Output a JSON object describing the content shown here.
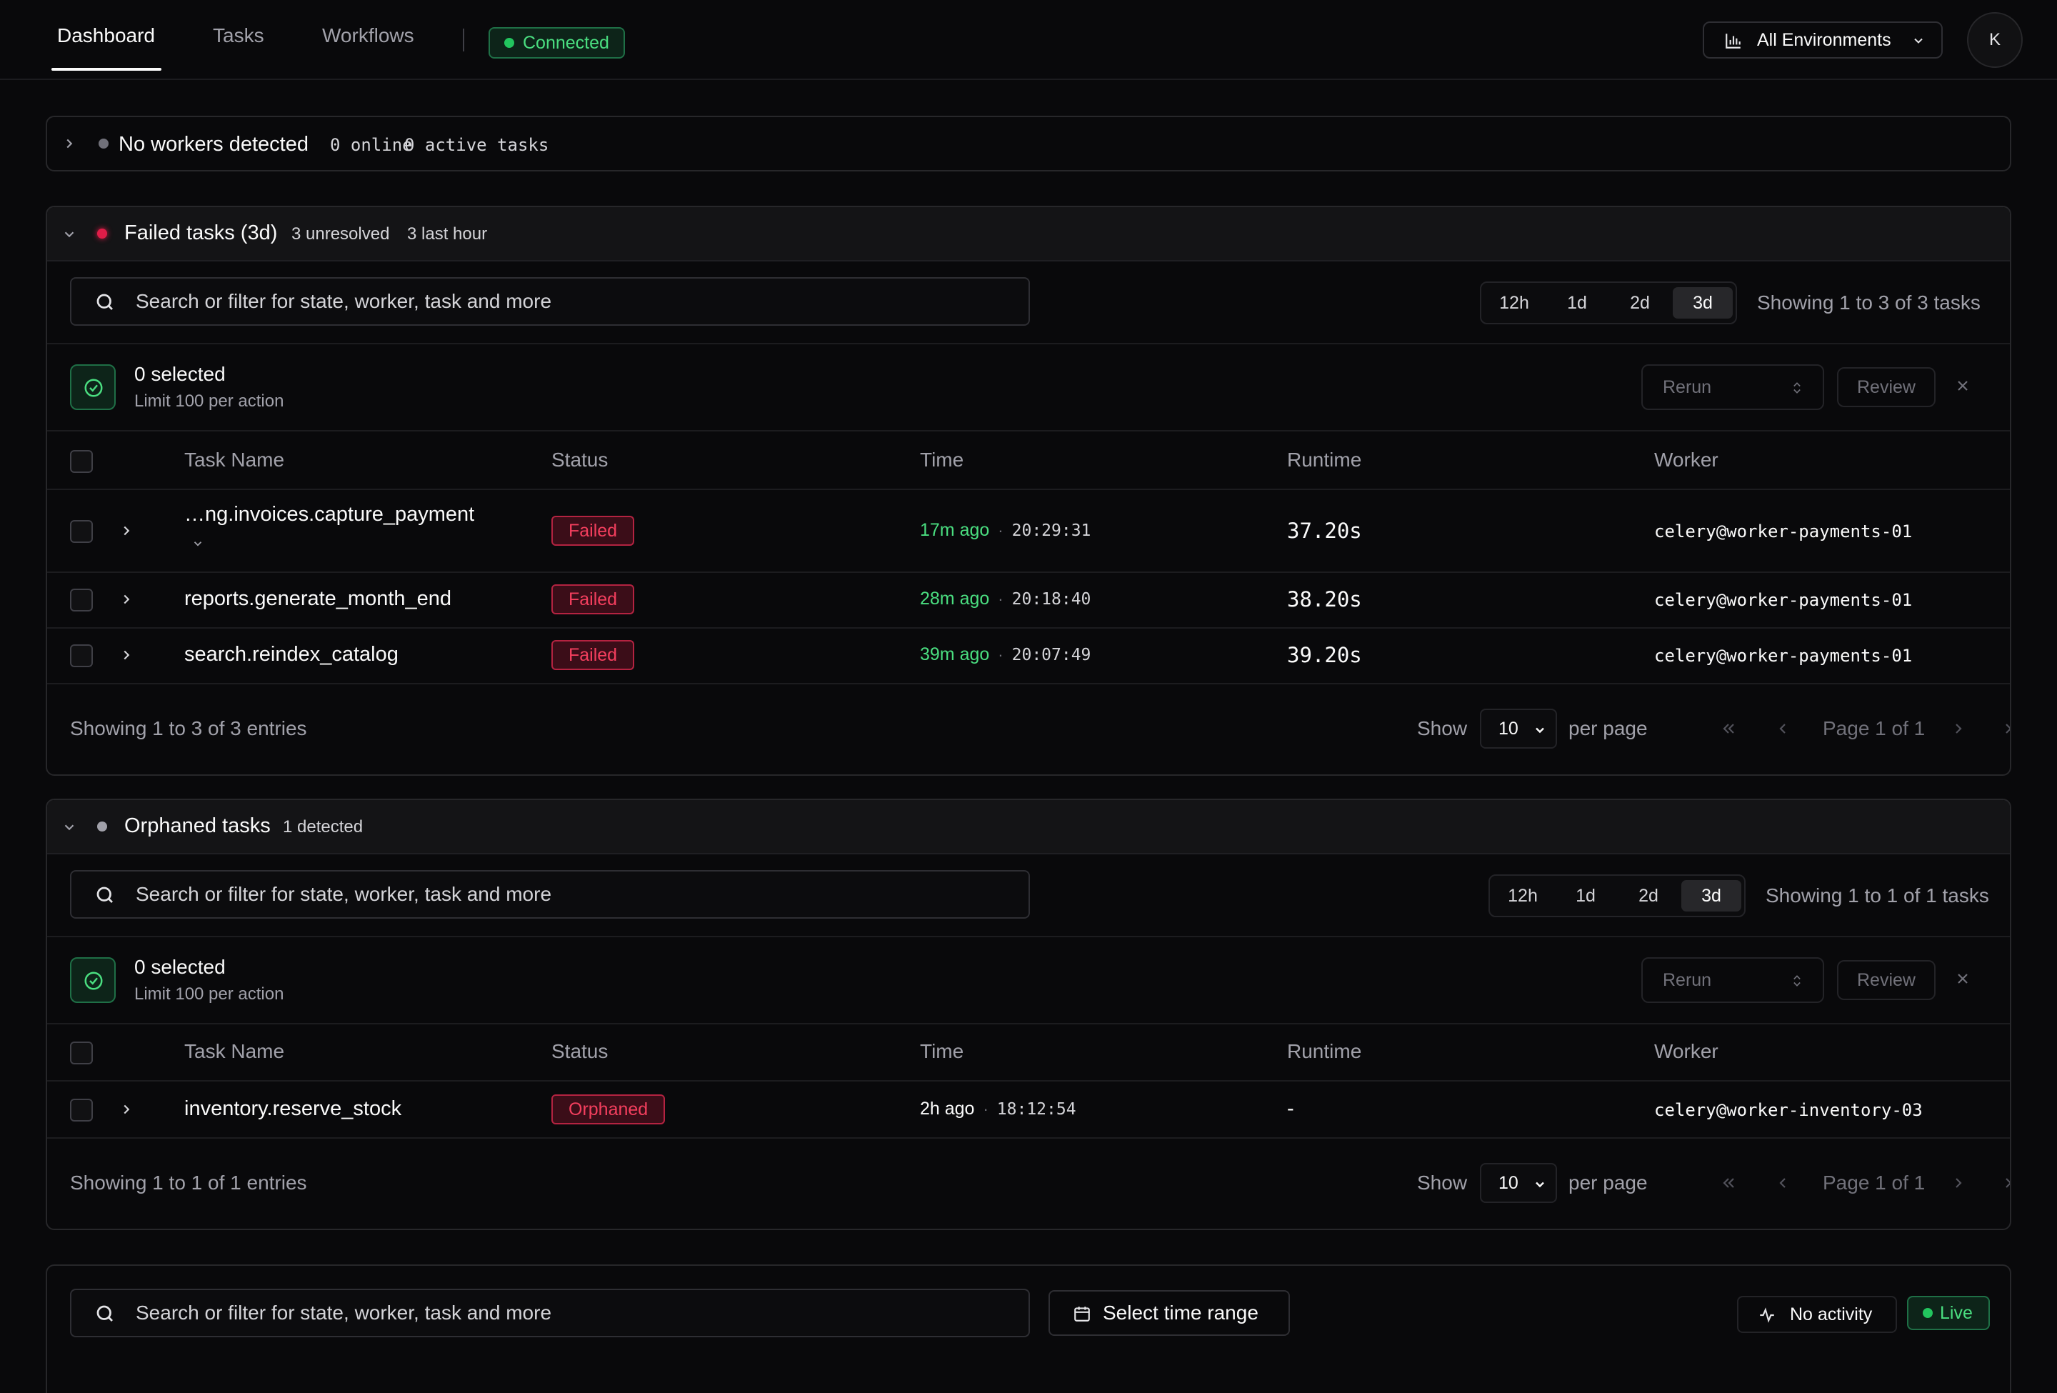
{
  "nav": {
    "tabs": [
      {
        "label": "Dashboard",
        "active": true
      },
      {
        "label": "Tasks",
        "active": false
      },
      {
        "label": "Workflows",
        "active": false
      }
    ],
    "connection_status": "Connected",
    "environment_label": "All Environments",
    "avatar_initial": "K"
  },
  "workers_panel": {
    "title": "No workers detected",
    "online": "0 online",
    "active_tasks": "0 active tasks"
  },
  "failed_panel": {
    "title": "Failed tasks (3d)",
    "unresolved": "3 unresolved",
    "last_hour": "3 last hour",
    "search_placeholder": "Search or filter for state, worker, task and more",
    "ranges": [
      "12h",
      "1d",
      "2d",
      "3d"
    ],
    "active_range": "3d",
    "range_summary": "Showing 1 to 3 of 3 tasks",
    "selected": "0 selected",
    "limit": "Limit 100 per action",
    "rerun_label": "Rerun",
    "review_label": "Review",
    "columns": [
      "Task Name",
      "Status",
      "Time",
      "Runtime",
      "Worker"
    ],
    "rows": [
      {
        "name": "…ng.invoices.capture_payment",
        "status": "Failed",
        "relative": "17m ago",
        "absolute": "20:29:31",
        "runtime": "37.20s",
        "worker": "celery@worker-payments-01"
      },
      {
        "name": "reports.generate_month_end",
        "status": "Failed",
        "relative": "28m ago",
        "absolute": "20:18:40",
        "runtime": "38.20s",
        "worker": "celery@worker-payments-01"
      },
      {
        "name": "search.reindex_catalog",
        "status": "Failed",
        "relative": "39m ago",
        "absolute": "20:07:49",
        "runtime": "39.20s",
        "worker": "celery@worker-payments-01"
      }
    ],
    "footer_summary": "Showing 1 to 3 of 3 entries",
    "show_label": "Show",
    "per_page_value": "10",
    "per_page_label": "per page",
    "page_label": "Page 1 of 1"
  },
  "orphaned_panel": {
    "title": "Orphaned tasks",
    "detected": "1 detected",
    "search_placeholder": "Search or filter for state, worker, task and more",
    "ranges": [
      "12h",
      "1d",
      "2d",
      "3d"
    ],
    "active_range": "3d",
    "range_summary": "Showing 1 to 1 of 1 tasks",
    "selected": "0 selected",
    "limit": "Limit 100 per action",
    "rerun_label": "Rerun",
    "review_label": "Review",
    "columns": [
      "Task Name",
      "Status",
      "Time",
      "Runtime",
      "Worker"
    ],
    "rows": [
      {
        "name": "inventory.reserve_stock",
        "status": "Orphaned",
        "relative": "2h ago",
        "absolute": "18:12:54",
        "runtime": "-",
        "worker": "celery@worker-inventory-03"
      }
    ],
    "footer_summary": "Showing 1 to 1 of 1 entries",
    "show_label": "Show",
    "per_page_value": "10",
    "per_page_label": "per page",
    "page_label": "Page 1 of 1"
  },
  "activity_panel": {
    "search_placeholder": "Search or filter for state, worker, task and more",
    "time_range_label": "Select time range",
    "activity_label": "No activity",
    "live_label": "Live"
  },
  "colors": {
    "background": "#09090b",
    "success": "#4ade80",
    "danger": "#f43f5e",
    "muted": "#a1a1aa"
  },
  "icons": [
    "chevron-right-icon",
    "chevron-down-icon",
    "search-icon",
    "check-circle-icon",
    "chart-bar-icon",
    "close-icon",
    "calendar-icon",
    "activity-icon",
    "sort-icon",
    "pager-first-icon",
    "pager-prev-icon",
    "pager-next-icon",
    "pager-last-icon"
  ]
}
